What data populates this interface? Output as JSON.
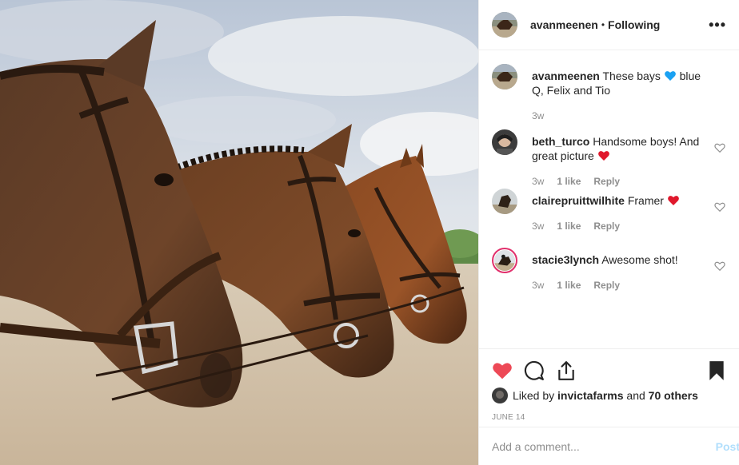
{
  "post": {
    "username": "avanmeenen",
    "separator": "•",
    "follow_status": "Following",
    "more_icon": "more-horizontal-icon"
  },
  "comments": [
    {
      "username": "avanmeenen",
      "text_before": "These bays",
      "emoji": "blue-heart",
      "text_after": "blue Q, Felix and Tio",
      "time": "3w"
    },
    {
      "username": "beth_turco",
      "text": "Handsome boys! And great picture",
      "emoji": "red-heart",
      "time": "3w",
      "likes": "1 like",
      "reply": "Reply"
    },
    {
      "username": "clairepruittwilhite",
      "text": "Framer",
      "emoji": "red-heart",
      "time": "3w",
      "likes": "1 like",
      "reply": "Reply"
    },
    {
      "username": "stacie3lynch",
      "text": "Awesome shot!",
      "time": "3w",
      "likes": "1 like",
      "reply": "Reply"
    }
  ],
  "actions": {
    "liked_prefix": "Liked by",
    "liked_user": "invictafarms",
    "liked_and": "and",
    "liked_others": "70 others",
    "date": "JUNE 14"
  },
  "add_comment": {
    "placeholder": "Add a comment...",
    "post_label": "Post"
  },
  "colors": {
    "like_red": "#ed4956",
    "post_blue_disabled": "#b2dffc",
    "meta_gray": "#8e8e8e"
  }
}
